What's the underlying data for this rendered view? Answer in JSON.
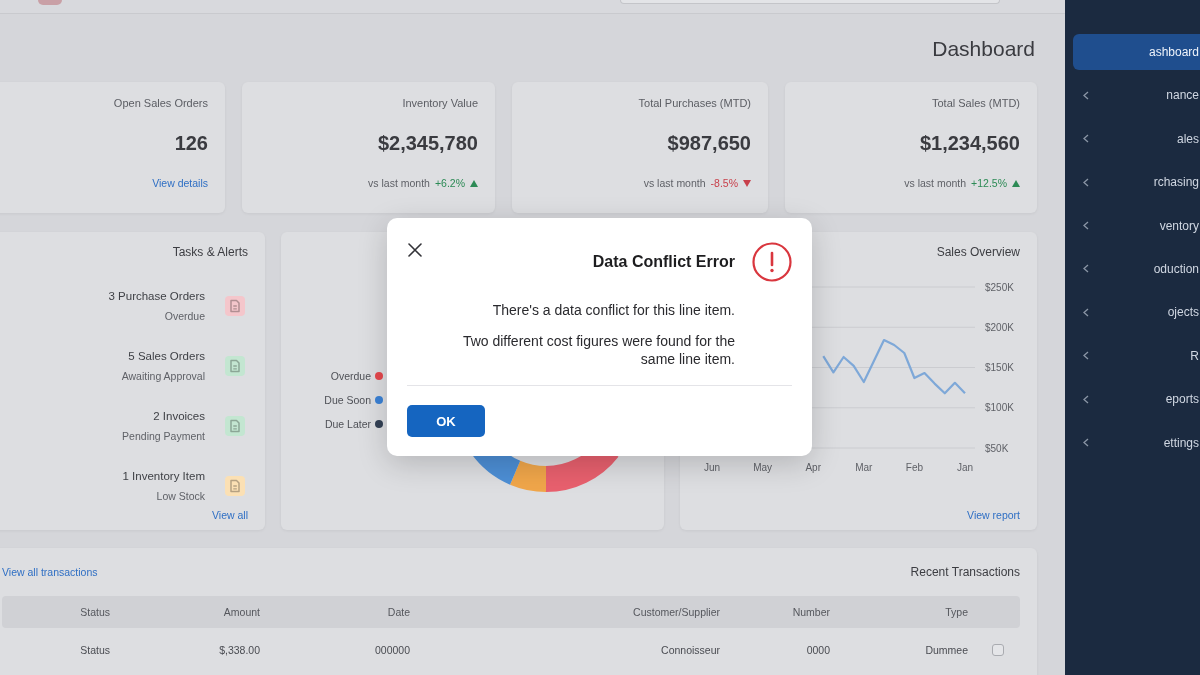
{
  "page_title": "Dashboard",
  "kpis": [
    {
      "kind": "link",
      "title": "Open Sales Orders",
      "value": "126",
      "link": "View details"
    },
    {
      "kind": "delta",
      "title": "Inventory Value",
      "value": "$2,345,780",
      "rising": true,
      "change": "+6.2%",
      "note": "vs last month"
    },
    {
      "kind": "delta",
      "title": "Total Purchases (MTD)",
      "value": "$987,650",
      "rising": false,
      "change": "-8.5%",
      "note": "vs last month"
    },
    {
      "kind": "delta",
      "title": "Total Sales (MTD)",
      "value": "$1,234,560",
      "rising": true,
      "change": "+12.5%",
      "note": "vs last month"
    }
  ],
  "tasks": {
    "title": "Tasks & Alerts",
    "items": [
      {
        "title": "3 Purchase Orders",
        "subtitle": "Overdue",
        "color": "#f4c6cb"
      },
      {
        "title": "5 Sales Orders",
        "subtitle": "Awaiting Approval",
        "color": "#c3e6d1"
      },
      {
        "title": "2 Invoices",
        "subtitle": "Pending Payment",
        "color": "#c3e6d1"
      },
      {
        "title": "1 Inventory Item",
        "subtitle": "Low Stock",
        "color": "#fbe0b4"
      }
    ],
    "link": "View all"
  },
  "status_breakdown": {
    "legend": [
      {
        "label": "Overdue",
        "color": "#e5484d"
      },
      {
        "label": "Due Soon",
        "color": "#3b82d6"
      },
      {
        "label": "Due Later",
        "color": "#334155"
      }
    ]
  },
  "sales_overview": {
    "title": "Sales Overview",
    "chart_data": {
      "type": "line",
      "grid": true,
      "categories": [
        "Jun",
        null,
        null,
        null,
        null,
        "May",
        null,
        null,
        null,
        null,
        "Apr",
        null,
        null,
        null,
        null,
        "Mar",
        null,
        null,
        null,
        null,
        "Feb",
        null,
        null,
        null,
        null,
        "Jan"
      ],
      "series": [
        {
          "color": "#7ea8d8",
          "values": [
            null,
            null,
            null,
            null,
            null,
            null,
            null,
            null,
            null,
            null,
            null,
            164,
            144,
            163,
            152,
            132,
            158,
            184,
            178,
            168,
            137,
            143,
            130,
            118,
            131,
            118
          ]
        }
      ],
      "ylim": [
        50,
        250
      ],
      "yticks": [
        {
          "value": 250,
          "label": "$250K"
        },
        {
          "value": 200,
          "label": "$200K"
        },
        {
          "value": 150,
          "label": "$150K"
        },
        {
          "value": 100,
          "label": "$100K"
        },
        {
          "value": 50,
          "label": "$50K"
        }
      ]
    },
    "link": "View report"
  },
  "transactions": {
    "title": "Recent Transactions",
    "link": "View all transactions",
    "columns": [
      "Status",
      "Amount",
      "Date",
      "Customer/Supplier",
      "Number",
      "Type"
    ],
    "rows": [
      {
        "checked": false,
        "cells": [
          "Status",
          "$,338.00",
          "000000",
          "Connoisseur",
          "0000",
          "Dummee"
        ]
      }
    ]
  },
  "sidebar": {
    "items": [
      {
        "label": "ashboard",
        "selected": true,
        "submenu": false
      },
      {
        "label": "nance",
        "selected": false,
        "submenu": true
      },
      {
        "label": "ales",
        "selected": false,
        "submenu": true
      },
      {
        "label": "rchasing",
        "selected": false,
        "submenu": true
      },
      {
        "label": "ventory",
        "selected": false,
        "submenu": true
      },
      {
        "label": "oduction",
        "selected": false,
        "submenu": true
      },
      {
        "label": "ojects",
        "selected": false,
        "submenu": true
      },
      {
        "label": "R",
        "selected": false,
        "submenu": true
      },
      {
        "label": "eports",
        "selected": false,
        "submenu": true
      },
      {
        "label": "ettings",
        "selected": false,
        "submenu": true
      }
    ]
  },
  "dialog": {
    "kind": "error",
    "title": "Data Conflict Error",
    "paragraphs": [
      "There's a data conflict for this line item.",
      "Two different cost figures were found for the same line item."
    ],
    "button": "OK"
  }
}
